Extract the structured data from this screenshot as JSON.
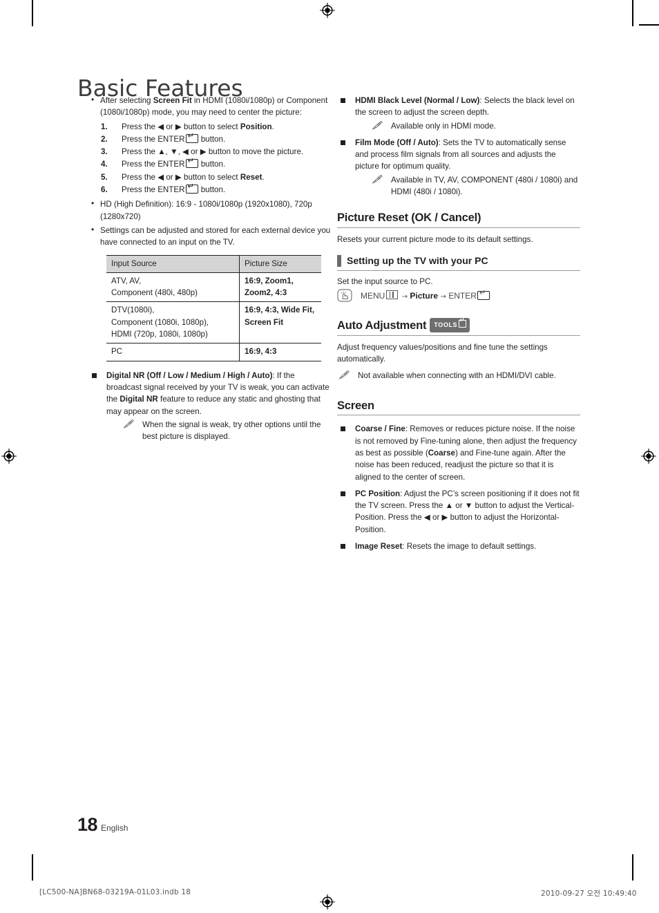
{
  "document": {
    "title": "Basic Features",
    "page_number": "18",
    "language": "English",
    "footer_left": "[LC500-NA]BN68-03219A-01L03.indb   18",
    "footer_right": "2010-09-27   오전 10:49:40"
  },
  "left_column": {
    "screen_fit_bullet": {
      "text_plain_1": "After selecting ",
      "bold_1": "Screen Fit",
      "text_plain_2": " in HDMI (1080i/1080p) or Component (1080i/1080p) mode, you may need to center the picture:"
    },
    "steps": [
      {
        "num": "1.",
        "pre": "Press the ◀ or ▶ button to select ",
        "bold": "Position",
        "post": "."
      },
      {
        "num": "2.",
        "pre": "Press the ENTER",
        "bold": "",
        "post": " button."
      },
      {
        "num": "3.",
        "pre": "Press the ▲, ▼, ◀ or ▶ button to move the picture.",
        "bold": "",
        "post": ""
      },
      {
        "num": "4.",
        "pre": "Press the ENTER",
        "bold": "",
        "post": " button."
      },
      {
        "num": "5.",
        "pre": "Press the ◀ or ▶ button to select ",
        "bold": "Reset",
        "post": "."
      },
      {
        "num": "6.",
        "pre": "Press the ENTER",
        "bold": "",
        "post": " button."
      }
    ],
    "hd_bullet": "HD (High Definition): 16:9 - 1080i/1080p (1920x1080), 720p (1280x720)",
    "settings_bullet": "Settings can be adjusted and stored for each external device you have connected to an input on the TV.",
    "table": {
      "headers": [
        "Input Source",
        "Picture Size"
      ],
      "rows": [
        {
          "source": "ATV, AV,\nComponent (480i, 480p)",
          "size": "16:9, Zoom1,\nZoom2, 4:3"
        },
        {
          "source": "DTV(1080i),\nComponent (1080i, 1080p),\nHDMI (720p, 1080i, 1080p)",
          "size": "16:9, 4:3, Wide Fit,\nScreen Fit"
        },
        {
          "source": "PC",
          "size": "16:9, 4:3"
        }
      ]
    },
    "digital_nr": {
      "bold_1": "Digital NR (Off / Low / Medium / High / Auto)",
      "text_1": ": If the broadcast signal received by your TV is weak, you can activate the ",
      "bold_2": "Digital NR",
      "text_2": " feature to reduce any static and ghosting that may appear on the screen.",
      "note": "When the signal is weak, try other options until the best picture is displayed."
    }
  },
  "right_column": {
    "hdmi_black_level": {
      "bold": "HDMI Black Level (Normal / Low)",
      "text": ": Selects the black level on the screen to adjust the screen depth.",
      "note": "Available only in HDMI mode."
    },
    "film_mode": {
      "bold": "Film Mode (Off / Auto)",
      "text": ": Sets the TV to automatically sense and process film signals from all sources and adjusts the picture for optimum quality.",
      "note": "Available in TV, AV, COMPONENT (480i / 1080i) and HDMI (480i / 1080i)."
    },
    "picture_reset": {
      "heading": "Picture Reset (OK / Cancel)",
      "body": "Resets your current picture mode to its default settings."
    },
    "setting_up_pc": {
      "heading": "Setting up the TV with your PC",
      "body": "Set the input source to PC.",
      "menu_path": {
        "menu_label": "MENU",
        "arrow_1": "→",
        "picture_label": "Picture",
        "arrow_2": "→",
        "enter_label": "ENTER"
      }
    },
    "auto_adjustment": {
      "heading": "Auto Adjustment",
      "tools_badge": "TOOLS",
      "body": "Adjust frequency values/positions and fine tune the settings automatically.",
      "note": "Not available when connecting with an HDMI/DVI cable."
    },
    "screen": {
      "heading": "Screen",
      "items": [
        {
          "bold_1": "Coarse / Fine",
          "text_1": ": Removes or reduces picture noise. If the noise is not removed by Fine-tuning alone, then adjust the frequency as best as possible (",
          "bold_2": "Coarse",
          "text_2": ") and Fine-tune again. After the noise has been reduced, readjust the picture so that it is aligned to the center of screen."
        },
        {
          "bold_1": "PC Position",
          "text_1": ": Adjust the PC’s screen positioning if it does not fit the TV screen. Press the ▲ or ▼ button to adjust the Vertical-Position. Press the ◀ or ▶ button to adjust the Horizontal-Position.",
          "bold_2": "",
          "text_2": ""
        },
        {
          "bold_1": "Image Reset",
          "text_1": ": Resets the image to default settings.",
          "bold_2": "",
          "text_2": ""
        }
      ]
    }
  }
}
